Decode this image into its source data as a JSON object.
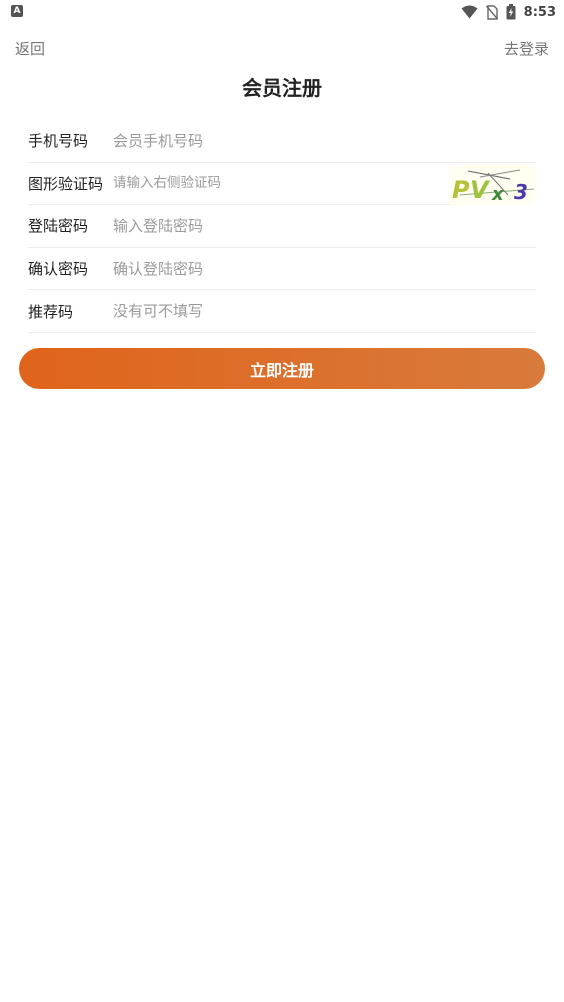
{
  "status_bar": {
    "left_icon_letter": "A",
    "time": "8:53",
    "icons": [
      "wifi-icon",
      "no-sim-icon",
      "battery-charging-icon"
    ]
  },
  "nav": {
    "back_label": "返回",
    "login_label": "去登录"
  },
  "title": "会员注册",
  "form": {
    "phone": {
      "label": "手机号码",
      "placeholder": "会员手机号码"
    },
    "captcha": {
      "label": "图形验证码",
      "placeholder": "请输入右侧验证码",
      "image_text": "PVx3"
    },
    "password": {
      "label": "登陆密码",
      "placeholder": "输入登陆密码"
    },
    "confirm_password": {
      "label": "确认密码",
      "placeholder": "确认登陆密码"
    },
    "referral": {
      "label": "推荐码",
      "placeholder": "没有可不填写"
    }
  },
  "submit_label": "立即注册",
  "colors": {
    "accent_start": "#e0641a",
    "accent_end": "#d87a3c"
  }
}
